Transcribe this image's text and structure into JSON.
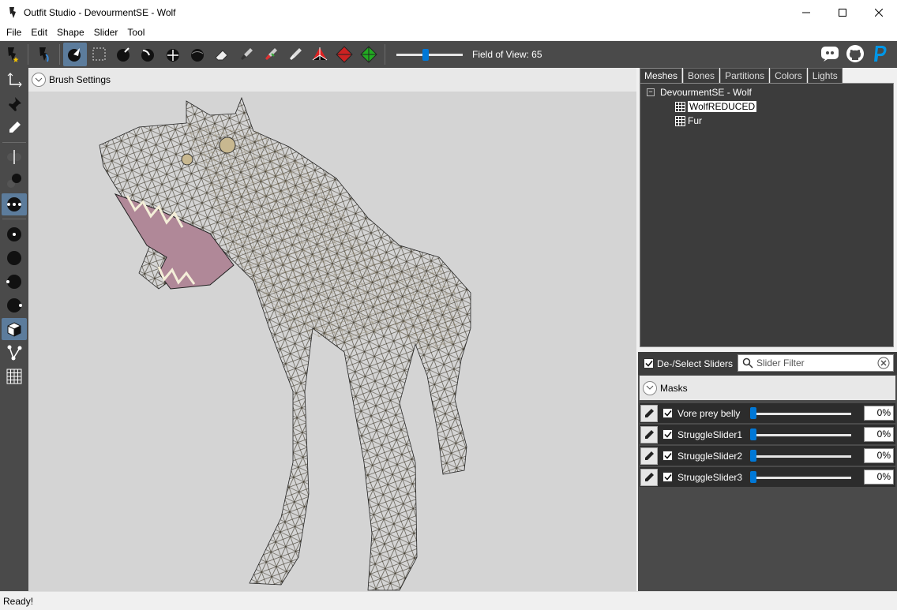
{
  "window": {
    "title": "Outfit Studio - DevourmentSE - Wolf"
  },
  "menu": [
    "File",
    "Edit",
    "Shape",
    "Slider",
    "Tool"
  ],
  "toolbar": {
    "fov_label": "Field of View: 65",
    "fov_value": 65
  },
  "viewport": {
    "brush_settings_label": "Brush Settings"
  },
  "tabs": [
    "Meshes",
    "Bones",
    "Partitions",
    "Colors",
    "Lights"
  ],
  "tree": {
    "root": "DevourmentSE - Wolf",
    "items": [
      "WolfREDUCED",
      "Fur"
    ],
    "selected": "WolfREDUCED"
  },
  "sliders_panel": {
    "select_label": "De-/Select Sliders",
    "filter_placeholder": "Slider Filter",
    "masks_label": "Masks",
    "sliders": [
      {
        "name": "Vore prey belly",
        "value": "0%"
      },
      {
        "name": "StruggleSlider1",
        "value": "0%"
      },
      {
        "name": "StruggleSlider2",
        "value": "0%"
      },
      {
        "name": "StruggleSlider3",
        "value": "0%"
      }
    ]
  },
  "status": "Ready!",
  "colors": {
    "accent": "#0078d7",
    "dark_panel": "#4a4a4a",
    "viewport_bg": "#d4d4d4"
  }
}
